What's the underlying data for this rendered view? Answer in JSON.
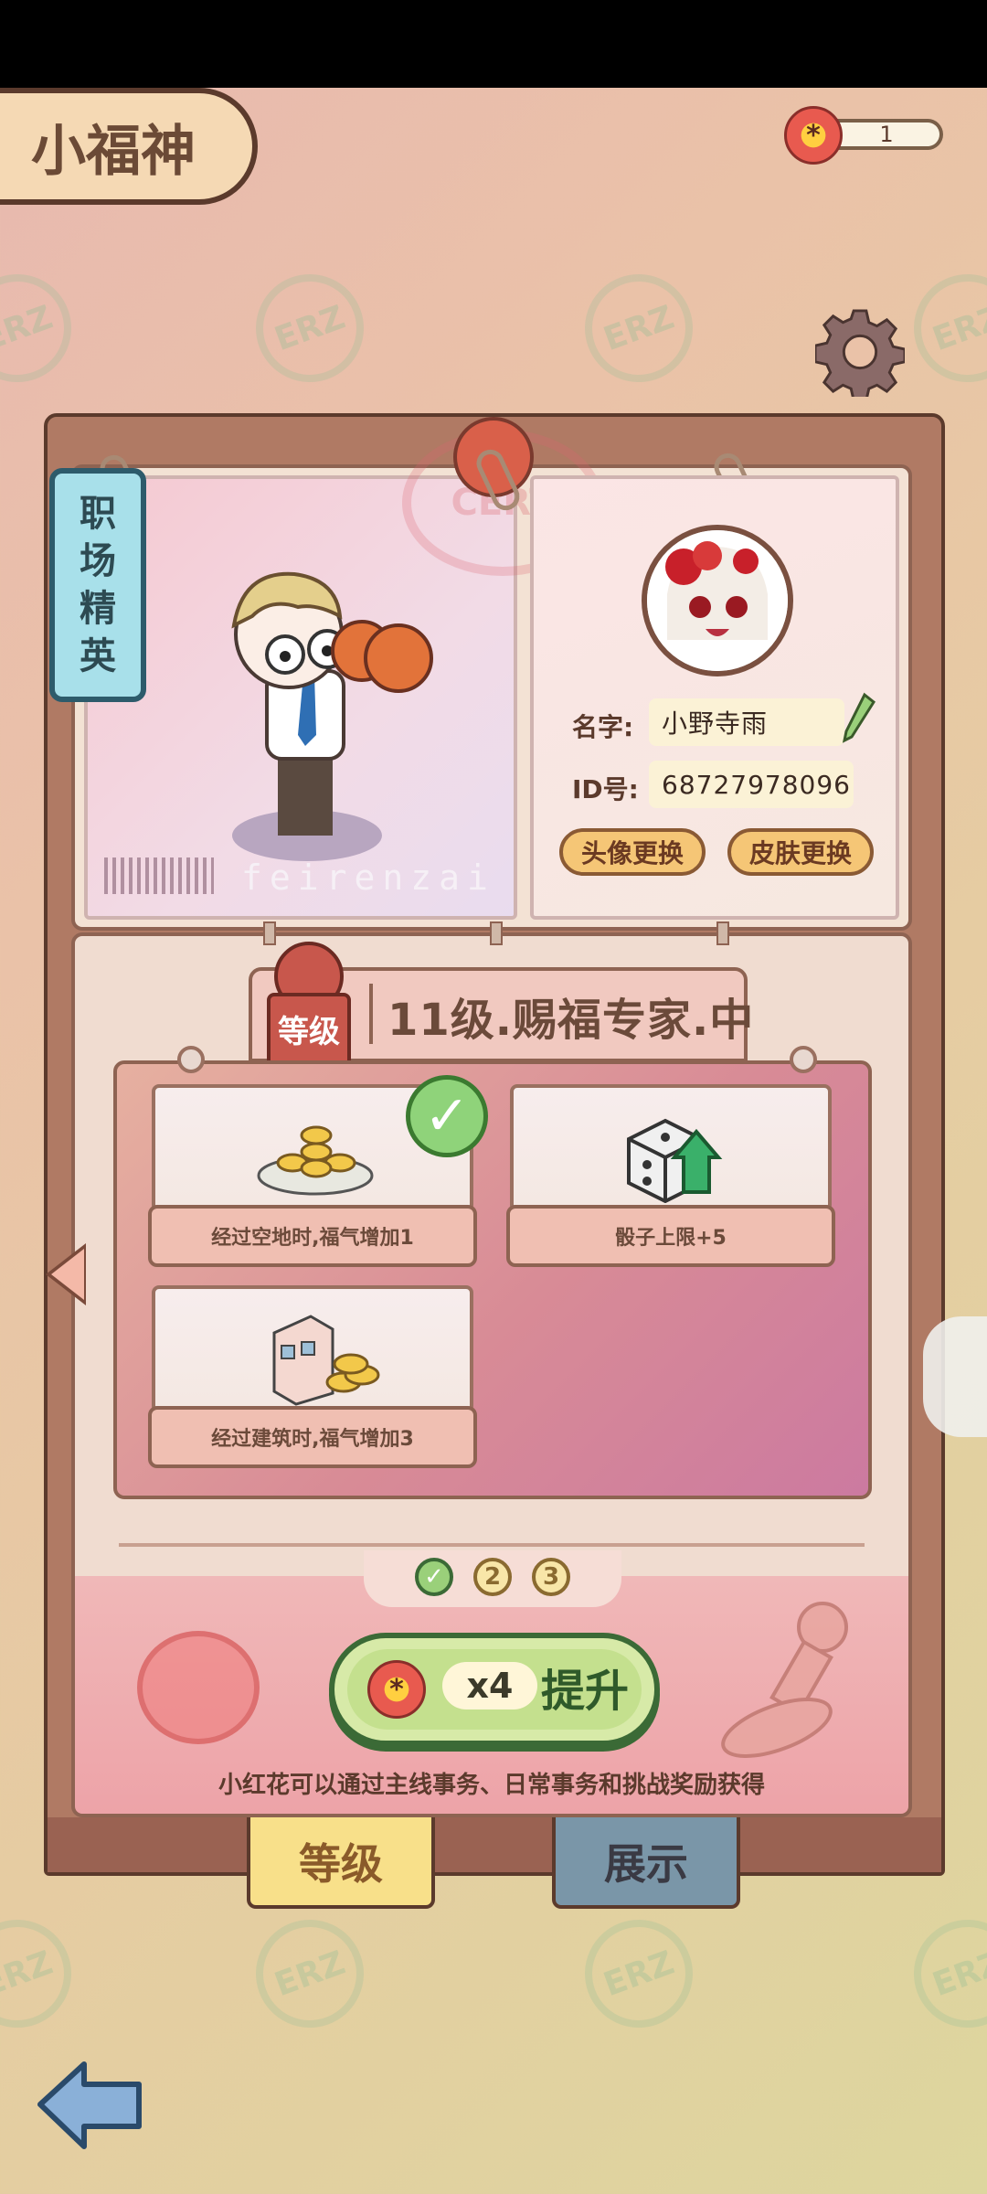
{
  "header": {
    "title": "小福神"
  },
  "currency": {
    "value": "1",
    "icon": "red-flower-icon"
  },
  "badge": {
    "chars": [
      "职",
      "场",
      "精",
      "英"
    ]
  },
  "stamp_text": "CERT",
  "photo_caption": "feirenzai",
  "profile": {
    "name_label": "名字:",
    "name_value": "小野寺雨",
    "id_label": "ID号:",
    "id_value": "68727978096",
    "avatar_btn": "头像更换",
    "skin_btn": "皮肤更换"
  },
  "level": {
    "badge": "等级",
    "text": "11级.赐福专家.中"
  },
  "perks": [
    {
      "label": "经过空地时,福气增加1",
      "icon": "gold-coins-icon",
      "done": true
    },
    {
      "label": "骰子上限+5",
      "icon": "dice-arrow-icon",
      "done": false
    },
    {
      "label": "经过建筑时,福气增加3",
      "icon": "building-coins-icon",
      "done": false
    }
  ],
  "steps": [
    "✓",
    "2",
    "3"
  ],
  "upgrade": {
    "multiplier": "x4",
    "label": "提升"
  },
  "hint": "小红花可以通过主线事务、日常事务和挑战奖励获得",
  "tabs": {
    "level": "等级",
    "display": "展示"
  },
  "colors": {
    "accent_green": "#3b6a36",
    "tab_yellow": "#f8e08a",
    "tab_blue": "#7a96a8"
  }
}
